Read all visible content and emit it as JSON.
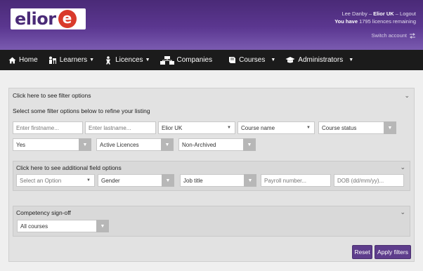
{
  "header": {
    "logo_text": "elior",
    "logo_mark": "e",
    "user_name": "Lee Danby",
    "org": "Elior UK",
    "logout": "Logout",
    "licences_prefix": "You have",
    "licences_count": "1795",
    "licences_suffix": "licences remaining",
    "switch_account": "Switch account",
    "colors": {
      "header_top": "#4a2a77",
      "header_bottom": "#7a5bb0",
      "logo_red": "#d93a2b"
    }
  },
  "nav": {
    "items": [
      {
        "label": "Home",
        "icon": "home-icon"
      },
      {
        "label": "Learners",
        "icon": "learners-icon",
        "dropdown": true
      },
      {
        "label": "Licences",
        "icon": "licences-icon",
        "dropdown": true
      },
      {
        "label": "Companies",
        "icon": "companies-icon"
      },
      {
        "label": "Courses",
        "icon": "book-icon",
        "dropdown": true
      },
      {
        "label": "Administrators",
        "icon": "graduation-cap-icon",
        "dropdown": true
      }
    ]
  },
  "filters": {
    "toggle_label": "Click here to see filter options",
    "subtitle": "Select some filter options below to refine your listing",
    "firstname_placeholder": "Enter firstname...",
    "lastname_placeholder": "Enter lastname...",
    "company": "Elior UK",
    "course_name": "Course name",
    "course_status": "Course status",
    "active_flag": "Yes",
    "licence_status": "Active Licences",
    "archive_status": "Non-Archived",
    "additional": {
      "toggle_label": "Click here to see additional field options",
      "option_placeholder": "Select an Option",
      "gender": "Gender",
      "job_title": "Job title",
      "payroll_placeholder": "Payroll number...",
      "dob_placeholder": "DOB (dd/mm/yy)..."
    },
    "competency": {
      "label": "Competency sign-off",
      "value": "All courses"
    },
    "reset_label": "Reset",
    "apply_label": "Apply filters"
  }
}
